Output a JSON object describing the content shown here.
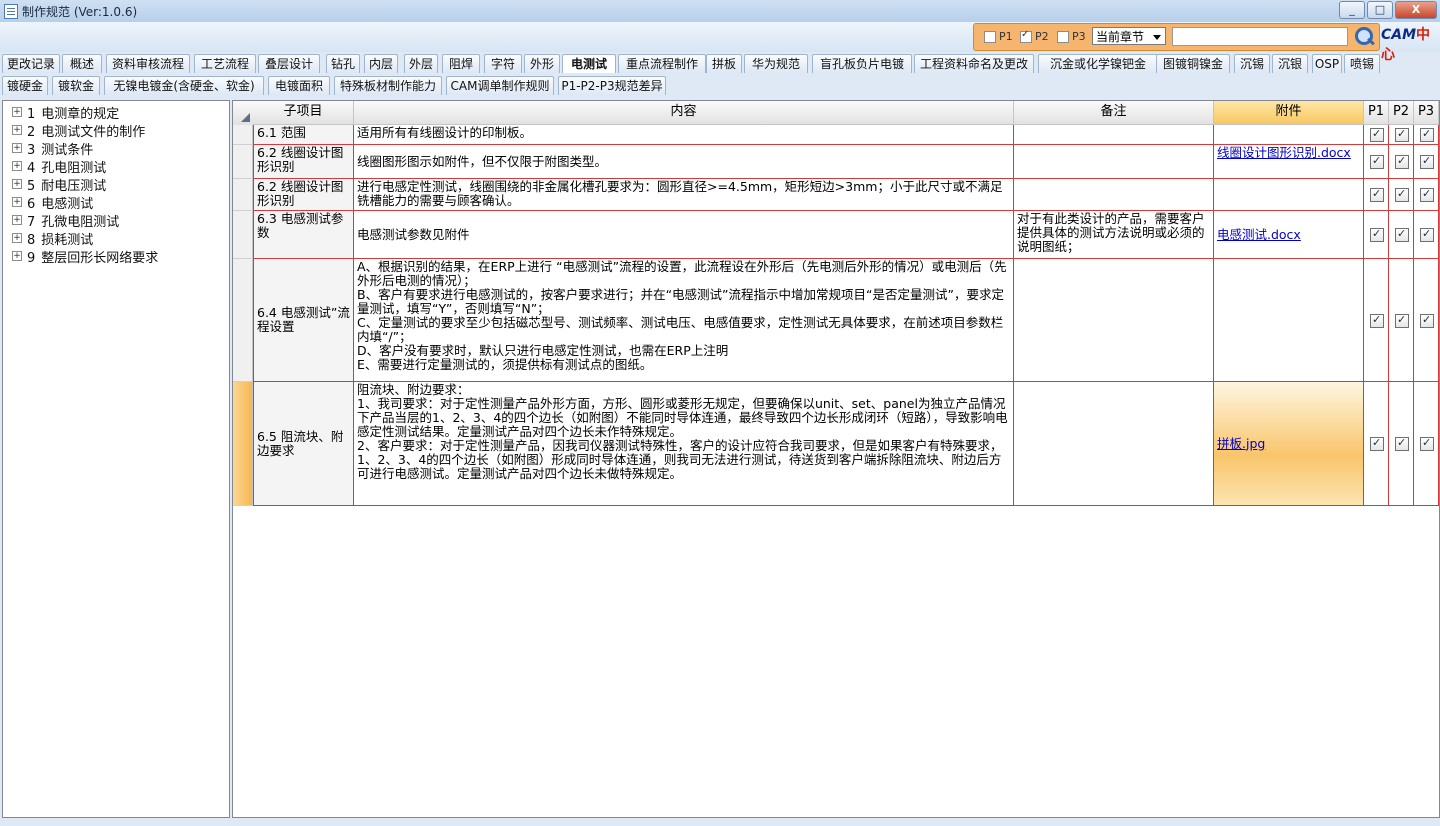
{
  "window": {
    "title": "制作规范 (Ver:1.0.6)",
    "minimize": "_",
    "maximize": "□",
    "close": "X"
  },
  "filter": {
    "p1_label": "P1",
    "p1_checked": false,
    "p2_label": "P2",
    "p2_checked": true,
    "p3_label": "P3",
    "p3_checked": false,
    "scope_selected": "当前章节",
    "search_value": "",
    "logo_text": "CAM",
    "logo_cn": "中心"
  },
  "tabs_row1": [
    "更改记录",
    "概述",
    "资料审核流程",
    "工艺流程",
    "叠层设计",
    "钻孔",
    "内层",
    "外层",
    "阻焊",
    "字符",
    "外形",
    "电测试",
    "重点流程制作",
    "拼板",
    "华为规范",
    "盲孔板负片电镀",
    "工程资料命名及更改",
    "沉金或化学镍钯金",
    "图镀铜镍金",
    "沉锡",
    "沉银",
    "OSP",
    "喷锡"
  ],
  "tabs_row2": [
    "镀硬金",
    "镀软金",
    "无镍电镀金(含硬金、软金)",
    "电镀面积",
    "特殊板材制作能力",
    "CAM调单制作规则",
    "P1-P2-P3规范差异"
  ],
  "active_tab": "电测试",
  "tree": [
    {
      "num": "1",
      "label": "电测章的规定"
    },
    {
      "num": "2",
      "label": "电测试文件的制作"
    },
    {
      "num": "3",
      "label": "测试条件"
    },
    {
      "num": "4",
      "label": "孔电阻测试"
    },
    {
      "num": "5",
      "label": "耐电压测试"
    },
    {
      "num": "6",
      "label": "电感测试"
    },
    {
      "num": "7",
      "label": "孔微电阻测试"
    },
    {
      "num": "8",
      "label": "损耗测试"
    },
    {
      "num": "9",
      "label": "整层回形长网络要求"
    }
  ],
  "grid": {
    "headers": {
      "sub": "子项目",
      "content": "内容",
      "note": "备注",
      "attach": "附件",
      "p1": "P1",
      "p2": "P2",
      "p3": "P3"
    },
    "rows": [
      {
        "sub": "6.1 范围",
        "content": "适用所有有线圈设计的印制板。",
        "note": "",
        "attach": "",
        "p1": true,
        "p2": true,
        "p3": true
      },
      {
        "sub": "6.2 线圈设计图形识别",
        "content": "线圈图形图示如附件，但不仅限于附图类型。",
        "note": "",
        "attach": "线圈设计图形识别.docx",
        "p1": true,
        "p2": true,
        "p3": true
      },
      {
        "sub": "6.2 线圈设计图形识别",
        "content": "进行电感定性测试，线圈围绕的非金属化槽孔要求为：圆形直径>=4.5mm，矩形短边>3mm；小于此尺寸或不满足铣槽能力的需要与顾客确认。",
        "note": "",
        "attach": "",
        "p1": true,
        "p2": true,
        "p3": true
      },
      {
        "sub": "6.3 电感测试参数",
        "content": "电感测试参数见附件",
        "note": "对于有此类设计的产品，需要客户提供具体的测试方法说明或必须的说明图纸；",
        "attach": "电感测试.docx",
        "p1": true,
        "p2": true,
        "p3": true
      },
      {
        "sub": "6.4 电感测试”流程设置",
        "content": "A、根据识别的结果，在ERP上进行 “电感测试”流程的设置，此流程设在外形后（先电测后外形的情况）或电测后（先外形后电测的情况）；\nB、客户有要求进行电感测试的，按客户要求进行；并在“电感测试”流程指示中增加常规项目“是否定量测试”，要求定量测试，填写“Y”，否则填写“N”；\nC、定量测试的要求至少包括磁芯型号、测试频率、测试电压、电感值要求，定性测试无具体要求，在前述项目参数栏内填“/”；\nD、客户没有要求时，默认只进行电感定性测试，也需在ERP上注明\nE、需要进行定量测试的，须提供标有测试点的图纸。",
        "note": "",
        "attach": "",
        "p1": true,
        "p2": true,
        "p3": true
      },
      {
        "sub": "6.5 阻流块、附边要求",
        "content": "阻流块、附边要求：\n1、我司要求：对于定性测量产品外形方面，方形、圆形或菱形无规定，但要确保以unit、set、panel为独立产品情况下产品当层的1、2、3、4的四个边长（如附图）不能同时导体连通，最终导致四个边长形成闭环（短路），导致影响电感定性测试结果。定量测试产品对四个边长未作特殊规定。\n2、客户要求：对于定性测量产品，因我司仪器测试特殊性，客户的设计应符合我司要求，但是如果客户有特殊要求，1、2、3、4的四个边长（如附图）形成同时导体连通，则我司无法进行测试，待送货到客户端拆除阻流块、附边后方可进行电感测试。定量测试产品对四个边长未做特殊规定。",
        "note": "",
        "attach": "拼板.jpg",
        "p1": true,
        "p2": true,
        "p3": true
      }
    ]
  }
}
